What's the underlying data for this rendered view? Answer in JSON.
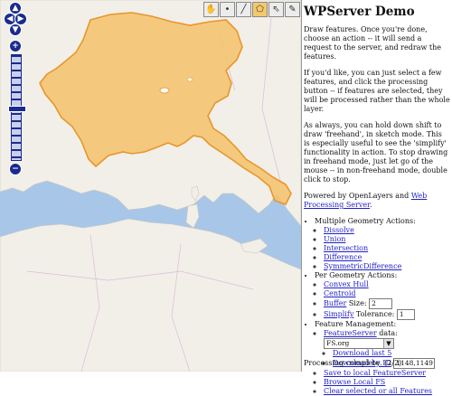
{
  "map": {
    "colors": {
      "sea": "#a8c7e8",
      "land": "#f2efe9",
      "selection": "#f5c26b",
      "selection_outline": "#e8962a"
    },
    "toolbar": [
      {
        "name": "navigate-tool",
        "icon": "hand-icon",
        "glyph": "✋",
        "active": false
      },
      {
        "name": "point-tool",
        "icon": "point-icon",
        "glyph": "•",
        "active": false
      },
      {
        "name": "line-tool",
        "icon": "line-icon",
        "glyph": "╱",
        "active": false
      },
      {
        "name": "polygon-tool",
        "icon": "polygon-icon",
        "glyph": "⬠",
        "active": true
      },
      {
        "name": "select-tool",
        "icon": "select-icon",
        "glyph": "⇖",
        "active": false
      },
      {
        "name": "modify-tool",
        "icon": "pencil-icon",
        "glyph": "✎",
        "active": false
      },
      {
        "name": "drag-tool",
        "icon": "move-icon",
        "glyph": "✥",
        "active": false
      }
    ],
    "panzoom": {
      "up": "▲",
      "left": "◀",
      "right": "▶",
      "down": "▼",
      "zoom_in": "+",
      "zoom_out": "−"
    }
  },
  "side": {
    "title": "WPServer Demo",
    "intro": "Draw features. Once you're done, choose an action -- it will send a request to the server, and redraw the features.",
    "select_hint": "If you'd like, you can just select a few features, and click the processing button -- if features are selected, they will be processed rather than the whole layer.",
    "freehand_hint": "As always, you can hold down shift to draw 'freehand', in sketch mode. This is especially useful to see the 'simplify' functionality in action. To stop drawing in freehand mode, just let go of the mouse -- in non-freehand mode, double click to stop.",
    "powered_prefix": "Powered by OpenLayers and ",
    "powered_link": "Web Processing Server",
    "powered_suffix": ".",
    "multi_heading": "Multiple Geometry Actions:",
    "multi_actions": [
      "Dissolve",
      "Union",
      "Intersection",
      "Difference",
      "SymmetricDifference"
    ],
    "per_heading": "Per Geometry Actions:",
    "convex_hull": "Convex Hull",
    "centroid": "Centroid",
    "buffer_link": "Buffer",
    "buffer_label": " Size: ",
    "buffer_value": "2",
    "simplify_link": "Simplify",
    "simplify_label": " Tolerance: ",
    "simplify_value": "1",
    "fm_heading": "Feature Management:",
    "featureserver_link": "FeatureServer",
    "featureserver_label": " data:",
    "fs_selected": "FS.org",
    "download_last": "Download last 5",
    "download_id": "Download by ID",
    "download_id_value": "1148,1149",
    "save_local": "Save to local FeatureServer",
    "browse_local": "Browse Local FS",
    "clear": "Clear selected or all Features",
    "status": "Processing complete. (2/2)"
  }
}
